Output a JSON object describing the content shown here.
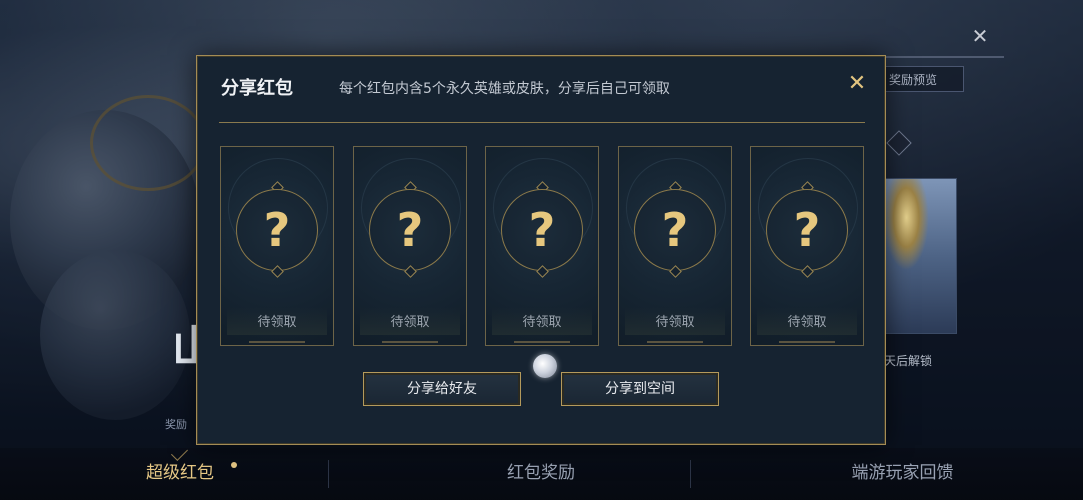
{
  "background": {
    "big_char": "山",
    "small_label": "奖励",
    "close_icon": "✕",
    "reward_preview": "奖励预览",
    "unlock_text": "天后解锁"
  },
  "modal": {
    "title": "分享红包",
    "subtitle": "每个红包内含5个永久英雄或皮肤，分享后自己可领取",
    "close_icon": "✕",
    "cards": [
      {
        "symbol": "?",
        "label": "待领取"
      },
      {
        "symbol": "?",
        "label": "待领取"
      },
      {
        "symbol": "?",
        "label": "待领取"
      },
      {
        "symbol": "?",
        "label": "待领取"
      },
      {
        "symbol": "?",
        "label": "待领取"
      }
    ],
    "share_friend_button": "分享给好友",
    "share_space_button": "分享到空间"
  },
  "tabs": [
    {
      "label": "超级红包",
      "active": true
    },
    {
      "label": "红包奖励",
      "active": false
    },
    {
      "label": "端游玩家回馈",
      "active": false
    }
  ],
  "colors": {
    "gold_accent": "#e6c77e",
    "modal_bg": "#162331",
    "border_gold": "#a48c55"
  }
}
